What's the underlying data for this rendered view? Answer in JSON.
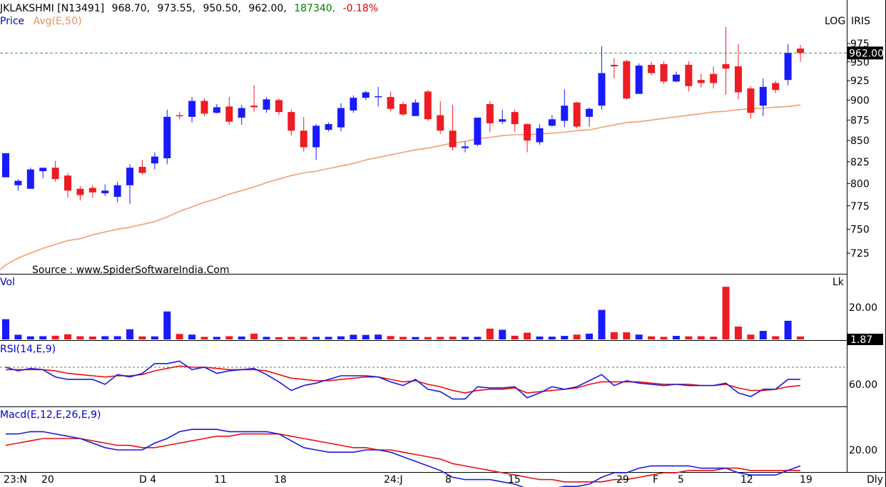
{
  "chart_data": {
    "type": "candlestick",
    "header": {
      "symbol": "JKLAKSHMI [N13491]",
      "open": "968.70,",
      "high": "973.55,",
      "low": "950.50,",
      "close": "962.00,",
      "volume": "187340,",
      "change": "-0.18%",
      "legend_price": "Price",
      "legend_avg": "Avg(E,50)",
      "log_label": "LOG",
      "brand_label": "IRIS",
      "source": "Source : www.SpiderSoftwareIndia.Com"
    },
    "colors": {
      "up": "#1a1aff",
      "down": "#ee1c24",
      "ema": "#f0a070",
      "rsi": "#1a1adf",
      "signal": "#e81010",
      "close_line": "#339933",
      "header_green": "#008000",
      "header_red": "#e00000",
      "legend_blue": "#0000cc"
    },
    "price_axis": {
      "scale": "log",
      "ticks": [
        "975",
        "950",
        "925",
        "900",
        "875",
        "850",
        "825",
        "800",
        "775",
        "750",
        "725"
      ],
      "current_label": "962.00",
      "current_value": 962
    },
    "x_labels": [
      "23:N",
      "20",
      "D 4",
      "11",
      "18",
      "24:J",
      "8",
      "15",
      "29",
      "F",
      "5",
      "12",
      "19",
      "Dly"
    ],
    "candles": [
      [
        807,
        835,
        782,
        782
      ],
      [
        798,
        803,
        792,
        805
      ],
      [
        794,
        816,
        794,
        818
      ],
      [
        814,
        818,
        806,
        816
      ],
      [
        818,
        805,
        802,
        826
      ],
      [
        809,
        792,
        784,
        812
      ],
      [
        794,
        787,
        781,
        797
      ],
      [
        795,
        790,
        784,
        798
      ],
      [
        789,
        792,
        786,
        799
      ],
      [
        785,
        798,
        779,
        802
      ],
      [
        798,
        818,
        777,
        822
      ],
      [
        819,
        812,
        810,
        827
      ],
      [
        823,
        831,
        816,
        836
      ],
      [
        829,
        879,
        822,
        888
      ],
      [
        881,
        880,
        876,
        885
      ],
      [
        879,
        899,
        872,
        904
      ],
      [
        899,
        883,
        880,
        902
      ],
      [
        884,
        891,
        883,
        895
      ],
      [
        892,
        873,
        869,
        904
      ],
      [
        878,
        890,
        869,
        894
      ],
      [
        893,
        891,
        885,
        919
      ],
      [
        888,
        901,
        884,
        904
      ],
      [
        900,
        885,
        881,
        902
      ],
      [
        885,
        862,
        856,
        888
      ],
      [
        862,
        842,
        837,
        879
      ],
      [
        842,
        868,
        827,
        870
      ],
      [
        863,
        870,
        861,
        872
      ],
      [
        866,
        890,
        861,
        896
      ],
      [
        887,
        903,
        884,
        906
      ],
      [
        903,
        910,
        900,
        912
      ],
      [
        905,
        905,
        892,
        917
      ],
      [
        904,
        889,
        886,
        911
      ],
      [
        895,
        882,
        880,
        898
      ],
      [
        880,
        897,
        880,
        901
      ],
      [
        911,
        876,
        874,
        913
      ],
      [
        881,
        862,
        858,
        899
      ],
      [
        862,
        842,
        838,
        894
      ],
      [
        841,
        843,
        836,
        849
      ],
      [
        845,
        878,
        843,
        878
      ],
      [
        895,
        871,
        860,
        899
      ],
      [
        873,
        876,
        870,
        888
      ],
      [
        885,
        870,
        861,
        888
      ],
      [
        870,
        850,
        836,
        871
      ],
      [
        848,
        865,
        845,
        870
      ],
      [
        868,
        876,
        867,
        881
      ],
      [
        874,
        893,
        866,
        914
      ],
      [
        897,
        867,
        865,
        898
      ],
      [
        879,
        889,
        867,
        891
      ],
      [
        893,
        935,
        888,
        971
      ],
      [
        946,
        944,
        928,
        955
      ],
      [
        951,
        902,
        901,
        953
      ],
      [
        908,
        945,
        908,
        948
      ],
      [
        946,
        935,
        932,
        950
      ],
      [
        947,
        924,
        921,
        951
      ],
      [
        924,
        933,
        923,
        937
      ],
      [
        946,
        918,
        911,
        951
      ],
      [
        926,
        922,
        916,
        934
      ],
      [
        934,
        922,
        915,
        944
      ],
      [
        947,
        941,
        907,
        998
      ],
      [
        944,
        910,
        901,
        974
      ],
      [
        915,
        884,
        877,
        918
      ],
      [
        893,
        917,
        880,
        928
      ],
      [
        922,
        913,
        909,
        925
      ],
      [
        926,
        962,
        919,
        974
      ],
      [
        968,
        962,
        950,
        973
      ]
    ],
    "ema50": [
      713,
      720,
      725,
      730,
      734,
      738,
      740,
      744,
      747,
      750,
      752,
      755,
      758,
      763,
      769,
      774,
      779,
      783,
      788,
      792,
      796,
      801,
      805,
      809,
      812,
      814,
      817,
      820,
      823,
      827,
      830,
      833,
      836,
      839,
      841,
      844,
      847,
      849,
      852,
      854,
      856,
      857,
      857,
      858,
      859,
      860,
      862,
      863,
      866,
      869,
      872,
      873,
      875,
      877,
      879,
      881,
      883,
      885,
      886,
      888,
      889,
      890,
      891,
      892,
      894
    ],
    "volume": {
      "title": "Vol",
      "unit": "Lk",
      "tick": "20.00",
      "current_label": "1.87",
      "values": [
        12.6,
        2.9,
        1.9,
        2.0,
        2.3,
        3.2,
        2.0,
        1.8,
        2.0,
        2.0,
        6.3,
        1.9,
        1.9,
        17.4,
        3.4,
        3.0,
        1.6,
        1.6,
        2.0,
        1.8,
        3.6,
        1.6,
        1.4,
        1.6,
        1.6,
        1.6,
        1.6,
        1.9,
        2.9,
        2.8,
        3.0,
        2.1,
        1.6,
        1.5,
        1.5,
        1.6,
        1.7,
        1.6,
        1.6,
        6.7,
        6.0,
        2.3,
        4.2,
        1.8,
        1.7,
        2.2,
        3.0,
        3.6,
        18.4,
        4.5,
        4.4,
        3.0,
        1.9,
        1.6,
        2.2,
        1.9,
        2.0,
        1.7,
        32.8,
        8.0,
        3.0,
        5.3,
        2.0,
        11.6,
        1.87
      ]
    },
    "rsi": {
      "title": "RSI(14,E,9)",
      "tick": "60.00",
      "ref_level": 74,
      "range": [
        40,
        85
      ],
      "values": [
        74,
        71,
        73,
        72,
        66,
        64,
        64,
        64,
        60,
        68,
        66,
        69,
        77,
        77,
        79,
        72,
        74,
        69,
        71,
        72,
        73,
        68,
        62,
        55,
        59,
        61,
        64,
        67,
        67,
        67,
        66,
        62,
        59,
        64,
        56,
        54,
        48,
        48,
        58,
        57,
        57,
        58,
        49,
        53,
        58,
        56,
        58,
        63,
        68,
        59,
        63,
        61,
        60,
        59,
        60,
        59,
        59,
        59,
        61,
        53,
        50,
        56,
        56,
        64,
        64
      ],
      "signal": [
        72,
        72,
        72,
        72,
        71,
        69,
        68,
        67,
        66,
        67,
        67,
        68,
        71,
        73,
        75,
        74,
        74,
        73,
        72,
        72,
        72,
        71,
        68,
        65,
        64,
        63,
        63,
        64,
        65,
        66,
        66,
        64,
        62,
        63,
        60,
        58,
        55,
        53,
        55,
        56,
        56,
        57,
        53,
        54,
        55,
        56,
        57,
        60,
        62,
        62,
        62,
        62,
        61,
        60,
        60,
        60,
        59,
        59,
        60,
        57,
        55,
        55,
        56,
        58,
        59
      ]
    },
    "macd": {
      "title": "Macd(E,12,E,26,E,9)",
      "tick": "20.00",
      "range": [
        3,
        35
      ],
      "values": [
        27,
        27,
        28,
        28,
        27,
        26,
        25,
        23,
        21,
        20,
        20,
        20,
        23,
        25,
        28,
        29,
        29,
        29,
        28,
        28,
        28,
        28,
        27,
        24,
        21,
        20,
        19,
        19,
        19,
        20,
        20,
        19,
        17,
        15,
        13,
        11,
        8,
        7,
        7,
        7,
        6,
        5,
        3,
        3,
        3,
        4,
        4,
        5,
        8,
        10,
        10,
        12,
        13,
        13,
        13,
        13,
        12,
        12,
        12,
        10,
        9,
        9,
        9,
        11,
        13
      ],
      "signal": [
        22,
        23,
        24,
        25,
        25,
        25,
        25,
        24,
        23,
        22,
        22,
        21,
        21,
        22,
        23,
        24,
        25,
        26,
        26,
        27,
        27,
        27,
        27,
        26,
        25,
        24,
        23,
        22,
        21,
        21,
        20,
        20,
        19,
        18,
        17,
        16,
        14,
        13,
        12,
        11,
        10,
        9,
        8,
        7,
        7,
        6,
        6,
        6,
        6,
        7,
        7,
        8,
        9,
        10,
        10,
        11,
        11,
        11,
        12,
        12,
        11,
        11,
        11,
        11,
        11
      ]
    }
  }
}
